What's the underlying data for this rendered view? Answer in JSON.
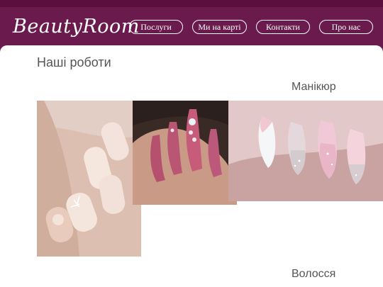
{
  "header": {
    "logo": "BeautyRoom",
    "nav": [
      {
        "label": "Послуги"
      },
      {
        "label": "Ми на карті"
      },
      {
        "label": "Контакти"
      },
      {
        "label": "Про нас"
      }
    ]
  },
  "main": {
    "section_title": "Наші роботи",
    "categories": [
      {
        "label": "Манікюр"
      },
      {
        "label": "Волосся"
      }
    ]
  },
  "colors": {
    "brand": "#6a1a4c",
    "background": "#ffffff"
  }
}
